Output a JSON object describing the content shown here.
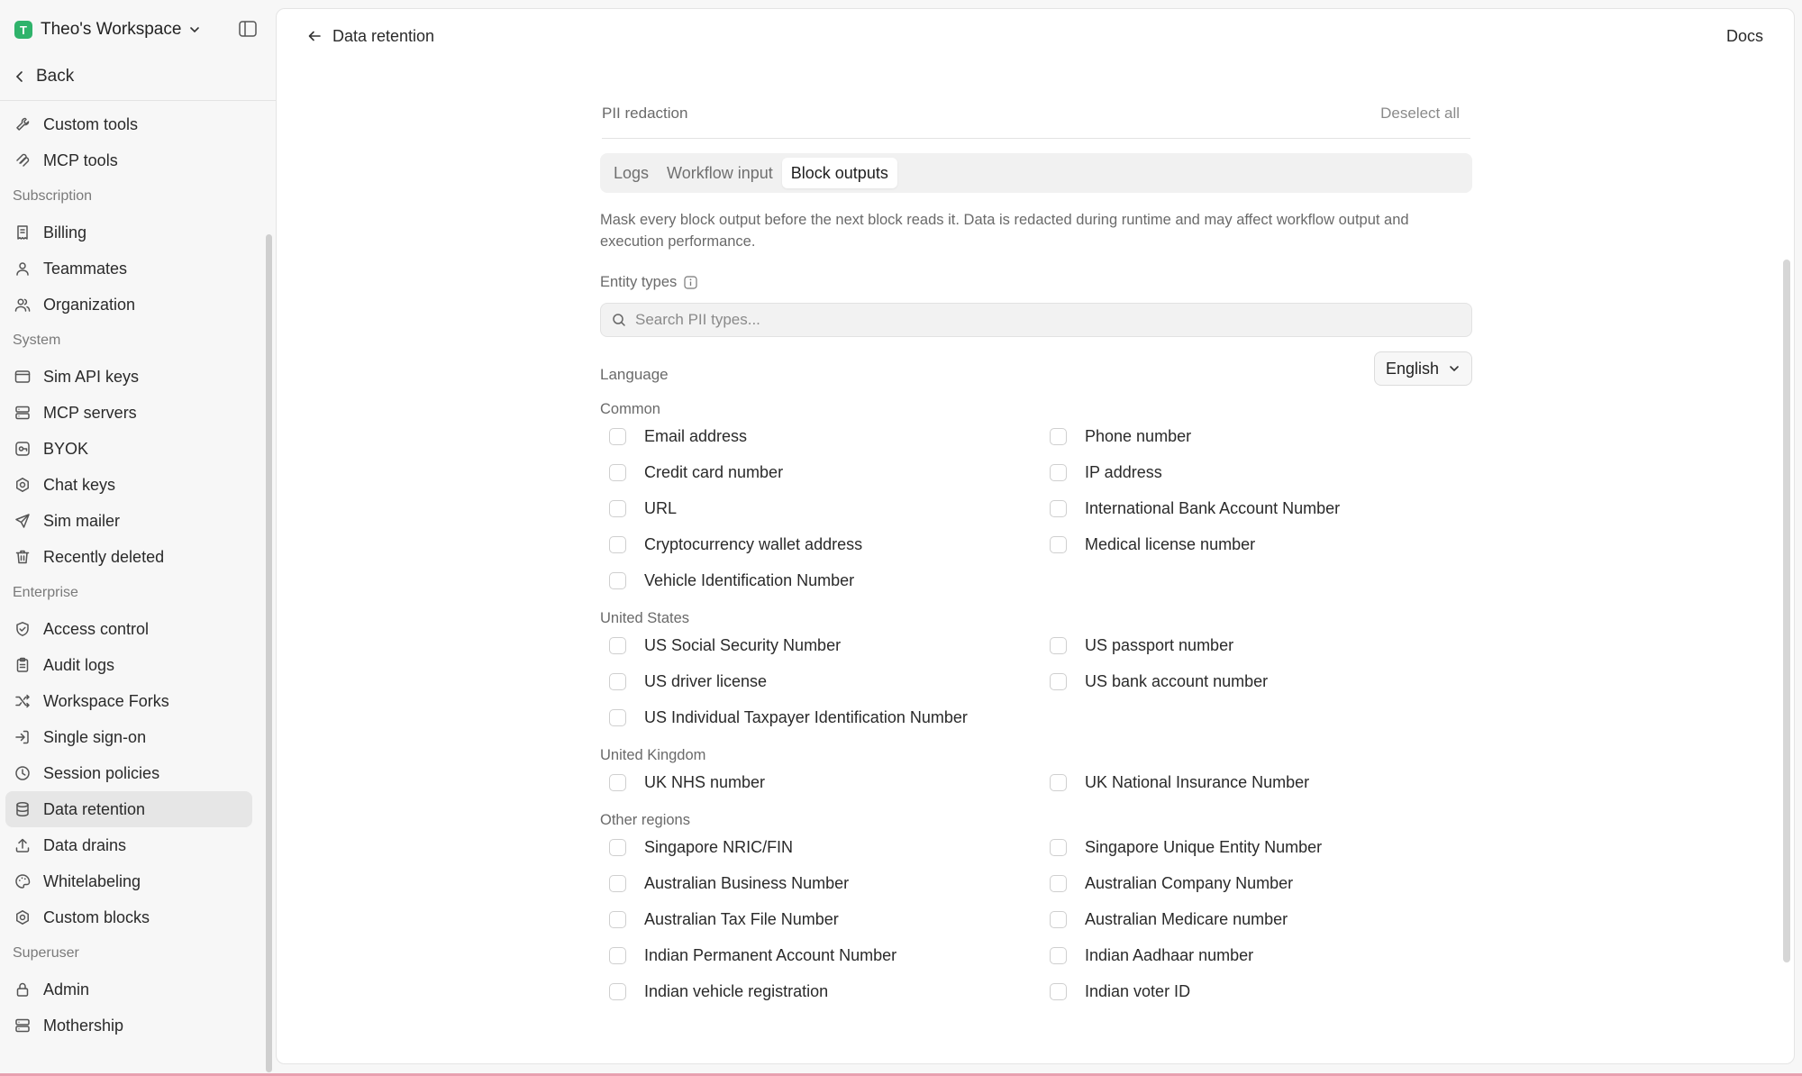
{
  "workspace": {
    "badge": "T",
    "name": "Theo's Workspace"
  },
  "sidebar": {
    "back": "Back",
    "items_top": [
      {
        "label": "Custom tools",
        "icon": "wrench-icon"
      },
      {
        "label": "MCP tools",
        "icon": "mcp-icon"
      }
    ],
    "sections": [
      {
        "title": "Subscription",
        "items": [
          {
            "label": "Billing",
            "icon": "receipt-icon"
          },
          {
            "label": "Teammates",
            "icon": "user-icon"
          },
          {
            "label": "Organization",
            "icon": "users-icon"
          }
        ]
      },
      {
        "title": "System",
        "items": [
          {
            "label": "Sim API keys",
            "icon": "browser-icon"
          },
          {
            "label": "MCP servers",
            "icon": "server-icon"
          },
          {
            "label": "BYOK",
            "icon": "key-card-icon"
          },
          {
            "label": "Chat keys",
            "icon": "hexagon-icon"
          },
          {
            "label": "Sim mailer",
            "icon": "send-icon"
          },
          {
            "label": "Recently deleted",
            "icon": "trash-icon"
          }
        ]
      },
      {
        "title": "Enterprise",
        "items": [
          {
            "label": "Access control",
            "icon": "shield-check-icon"
          },
          {
            "label": "Audit logs",
            "icon": "clipboard-icon"
          },
          {
            "label": "Workspace Forks",
            "icon": "shuffle-icon"
          },
          {
            "label": "Single sign-on",
            "icon": "login-icon"
          },
          {
            "label": "Session policies",
            "icon": "clock-icon"
          },
          {
            "label": "Data retention",
            "icon": "database-icon",
            "active": true
          },
          {
            "label": "Data drains",
            "icon": "upload-icon"
          },
          {
            "label": "Whitelabeling",
            "icon": "palette-icon"
          },
          {
            "label": "Custom blocks",
            "icon": "hexagon-icon"
          }
        ]
      },
      {
        "title": "Superuser",
        "items": [
          {
            "label": "Admin",
            "icon": "lock-icon"
          },
          {
            "label": "Mothership",
            "icon": "server-icon"
          }
        ]
      }
    ]
  },
  "header": {
    "title": "Data retention",
    "docs": "Docs"
  },
  "pii": {
    "title": "PII redaction",
    "deselect_all": "Deselect all",
    "tabs": [
      {
        "label": "Logs",
        "active": false
      },
      {
        "label": "Workflow input",
        "active": false
      },
      {
        "label": "Block outputs",
        "active": true
      }
    ],
    "description_line1": "Mask every block output before the next block reads it. Data is redacted during runtime and may affect workflow output and",
    "description_line2": "execution performance.",
    "entity_types_label": "Entity types",
    "search_placeholder": "Search PII types...",
    "language_label": "Language",
    "language_value": "English",
    "groups": [
      {
        "title": "Common",
        "options": [
          "Email address",
          "Phone number",
          "Credit card number",
          "IP address",
          "URL",
          "International Bank Account Number",
          "Cryptocurrency wallet address",
          "Medical license number",
          "Vehicle Identification Number"
        ]
      },
      {
        "title": "United States",
        "options": [
          "US Social Security Number",
          "US passport number",
          "US driver license",
          "US bank account number",
          "US Individual Taxpayer Identification Number"
        ]
      },
      {
        "title": "United Kingdom",
        "options": [
          "UK NHS number",
          "UK National Insurance Number"
        ]
      },
      {
        "title": "Other regions",
        "options": [
          "Singapore NRIC/FIN",
          "Singapore Unique Entity Number",
          "Australian Business Number",
          "Australian Company Number",
          "Australian Tax File Number",
          "Australian Medicare number",
          "Indian Permanent Account Number",
          "Indian Aadhaar number",
          "Indian vehicle registration",
          "Indian voter ID"
        ]
      }
    ]
  }
}
